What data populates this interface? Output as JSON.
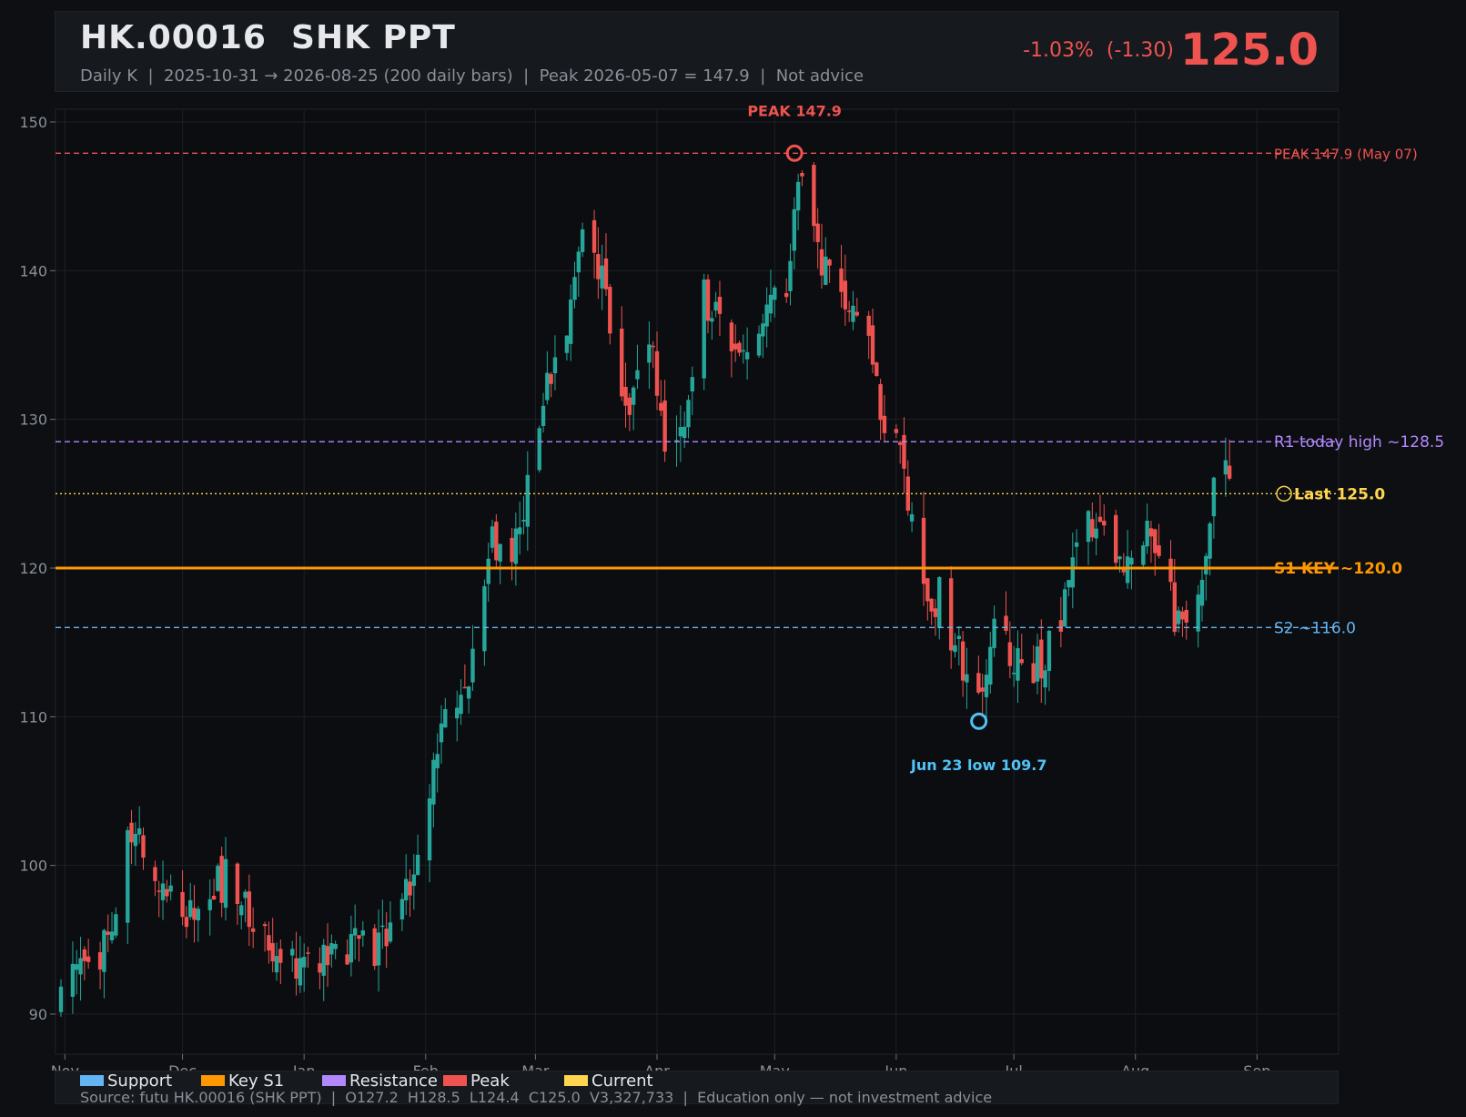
{
  "header": {
    "title": "HK.00016  SHK PPT",
    "subtitle": "Daily K  |  2025-10-31 → 2026-08-25 (200 daily bars)  |  Peak 2026-05-07 = 147.9  |  Not advice",
    "change": "-1.03%  (-1.30)",
    "price": "125.0"
  },
  "colors": {
    "up": "#26a69a",
    "down": "#ef5350",
    "support": "#64b5f6",
    "key_support": "#ff9800",
    "resistance": "#b388ff",
    "peak": "#ef5350",
    "current": "#ffd54f",
    "low_marker": "#4fc3f7"
  },
  "legend": [
    {
      "label": "Support",
      "color": "#64b5f6"
    },
    {
      "label": "Key S1",
      "color": "#ff9800"
    },
    {
      "label": "Resistance",
      "color": "#b388ff"
    },
    {
      "label": "Peak",
      "color": "#ef5350"
    },
    {
      "label": "Current",
      "color": "#ffd54f"
    }
  ],
  "footer": {
    "source": "Source: futu HK.00016 (SHK PPT)  |  O127.2  H128.5  L124.4  C125.0  V3,327,733  |  Education only — not investment advice"
  },
  "chart_data": {
    "type": "candlestick",
    "ylim": [
      89,
      151
    ],
    "yticks": [
      90,
      100,
      110,
      120,
      130,
      140,
      150
    ],
    "xticks": [
      {
        "label": "Nov",
        "date": "2025-11-01"
      },
      {
        "label": "Dec",
        "date": "2025-12-01"
      },
      {
        "label": "Jan",
        "date": "2026-01-01"
      },
      {
        "label": "Feb",
        "date": "2026-02-01"
      },
      {
        "label": "Mar",
        "date": "2026-03-01"
      },
      {
        "label": "Apr",
        "date": "2026-04-01"
      },
      {
        "label": "May",
        "date": "2026-05-01"
      },
      {
        "label": "Jun",
        "date": "2026-06-01"
      },
      {
        "label": "Jul",
        "date": "2026-07-01"
      },
      {
        "label": "Aug",
        "date": "2026-08-01"
      },
      {
        "label": "Sep",
        "date": "2026-09-01"
      }
    ],
    "date_range": [
      "2025-10-31",
      "2026-08-25"
    ],
    "grid": true,
    "trend_close": [
      [
        "2025-10-31",
        90.8
      ],
      [
        "2025-11-05",
        92.8
      ],
      [
        "2025-11-12",
        94.8
      ],
      [
        "2025-11-18",
        102.5
      ],
      [
        "2025-11-24",
        99.5
      ],
      [
        "2025-12-03",
        96.8
      ],
      [
        "2025-12-12",
        99.2
      ],
      [
        "2025-12-22",
        95.2
      ],
      [
        "2026-01-02",
        93.0
      ],
      [
        "2026-01-12",
        94.8
      ],
      [
        "2026-01-20",
        94.0
      ],
      [
        "2026-01-28",
        99.0
      ],
      [
        "2026-02-05",
        108.5
      ],
      [
        "2026-02-12",
        113.5
      ],
      [
        "2026-02-18",
        122.0
      ],
      [
        "2026-02-24",
        121.5
      ],
      [
        "2026-03-02",
        130.5
      ],
      [
        "2026-03-09",
        136.5
      ],
      [
        "2026-03-13",
        143.0
      ],
      [
        "2026-03-18",
        139.5
      ],
      [
        "2026-03-24",
        131.0
      ],
      [
        "2026-03-30",
        135.5
      ],
      [
        "2026-04-03",
        127.5
      ],
      [
        "2026-04-08",
        131.0
      ],
      [
        "2026-04-13",
        138.5
      ],
      [
        "2026-04-17",
        137.0
      ],
      [
        "2026-04-23",
        134.5
      ],
      [
        "2026-04-29",
        138.0
      ],
      [
        "2026-05-04",
        139.0
      ],
      [
        "2026-05-07",
        146.0
      ],
      [
        "2026-05-12",
        141.0
      ],
      [
        "2026-05-18",
        137.5
      ],
      [
        "2026-05-22",
        138.0
      ],
      [
        "2026-05-28",
        131.0
      ],
      [
        "2026-06-03",
        126.5
      ],
      [
        "2026-06-08",
        118.5
      ],
      [
        "2026-06-12",
        118.0
      ],
      [
        "2026-06-17",
        114.5
      ],
      [
        "2026-06-23",
        111.0
      ],
      [
        "2026-06-26",
        115.5
      ],
      [
        "2026-07-02",
        114.0
      ],
      [
        "2026-07-09",
        113.5
      ],
      [
        "2026-07-15",
        118.5
      ],
      [
        "2026-07-20",
        123.0
      ],
      [
        "2026-07-24",
        122.0
      ],
      [
        "2026-07-30",
        120.5
      ],
      [
        "2026-08-04",
        123.5
      ],
      [
        "2026-08-07",
        121.5
      ],
      [
        "2026-08-12",
        116.0
      ],
      [
        "2026-08-17",
        117.0
      ],
      [
        "2026-08-20",
        124.5
      ],
      [
        "2026-08-24",
        127.0
      ],
      [
        "2026-08-25",
        125.0
      ]
    ],
    "levels": [
      {
        "label": "PEAK 147.9 (May 07)",
        "value": 147.9,
        "role": "peak",
        "style": "dashed"
      },
      {
        "label": "R1 today high ~128.5",
        "value": 128.5,
        "role": "resistance",
        "style": "dashed"
      },
      {
        "label": "Last 125.0",
        "value": 125.0,
        "role": "current",
        "style": "dotted"
      },
      {
        "label": "S1 KEY ~120.0",
        "value": 120.0,
        "role": "key_support",
        "style": "solid"
      },
      {
        "label": "S2 ~116.0",
        "value": 116.0,
        "role": "support",
        "style": "dashed"
      }
    ],
    "annotations": [
      {
        "label": "PEAK 147.9",
        "date": "2026-05-07",
        "value": 147.9,
        "role": "peak",
        "position": "above"
      },
      {
        "label": "Jun 23 low 109.7",
        "date": "2026-06-23",
        "value": 109.7,
        "role": "low_marker",
        "position": "below"
      }
    ]
  }
}
